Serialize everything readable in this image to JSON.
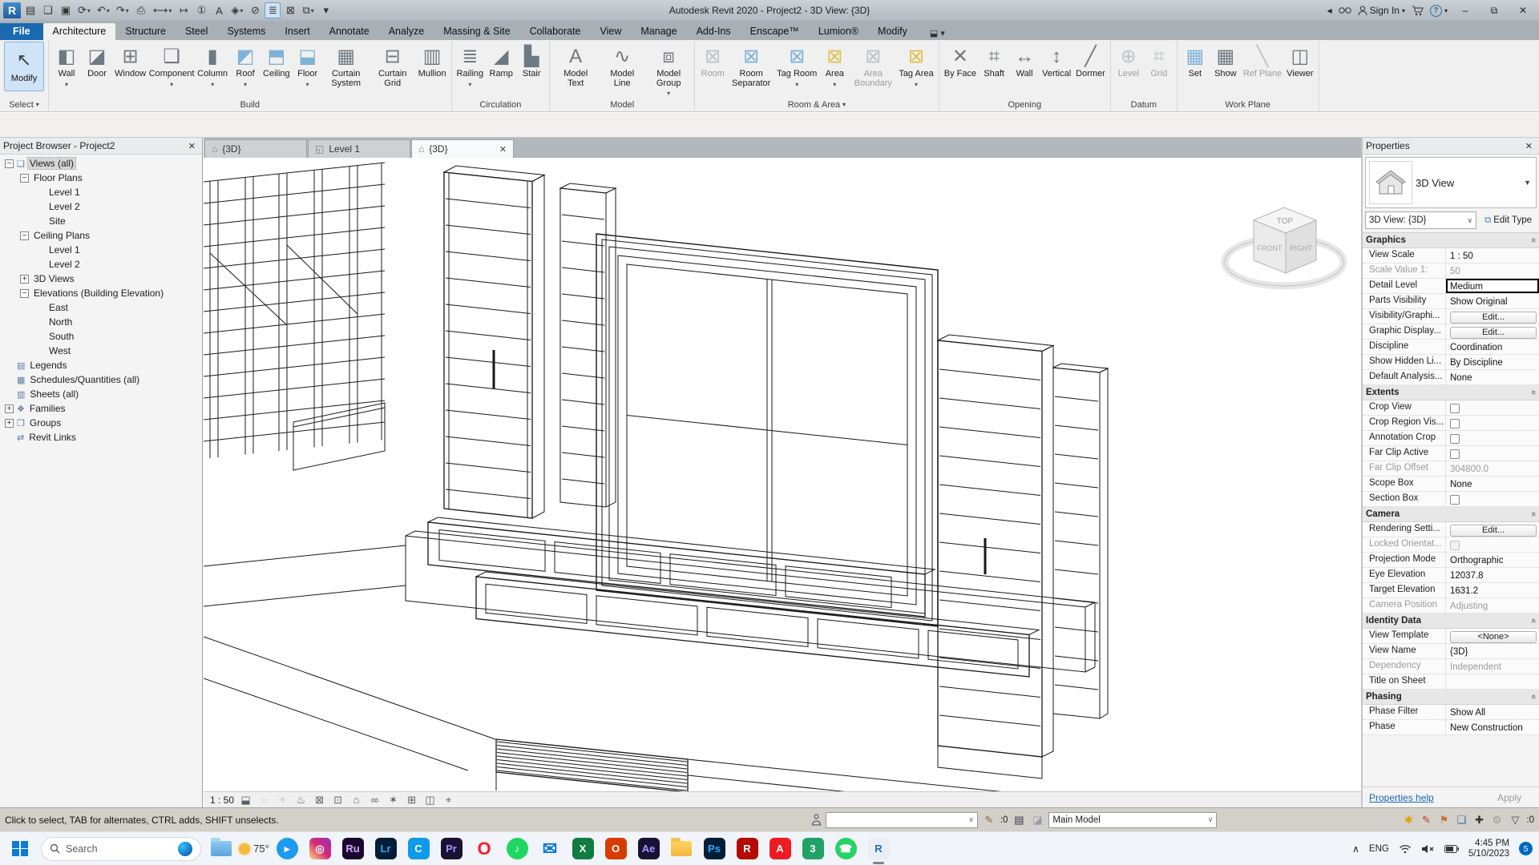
{
  "titlebar": {
    "title": "Autodesk Revit 2020 - Project2 - 3D View: {3D}",
    "sign_in": "Sign In",
    "qat": [
      {
        "name": "recent-documents",
        "glyph": "▤"
      },
      {
        "name": "open",
        "glyph": "❏"
      },
      {
        "name": "save",
        "glyph": "▣"
      },
      {
        "name": "sync",
        "glyph": "⟳",
        "arrow": true
      },
      {
        "name": "undo",
        "glyph": "↶",
        "arrow": true
      },
      {
        "name": "redo",
        "glyph": "↷",
        "arrow": true
      },
      {
        "name": "print",
        "glyph": "⎙"
      },
      {
        "name": "measure",
        "glyph": "⟷",
        "arrow": true
      },
      {
        "name": "aligned-dimension",
        "glyph": "↦"
      },
      {
        "name": "tag-by-category",
        "glyph": "①"
      },
      {
        "name": "text",
        "glyph": "A"
      },
      {
        "name": "default-3d-view",
        "glyph": "◈",
        "arrow": true
      },
      {
        "name": "section",
        "glyph": "⊘"
      },
      {
        "name": "thin-lines",
        "glyph": "≣",
        "active": true
      },
      {
        "name": "close-hidden-windows",
        "glyph": "⊠"
      },
      {
        "name": "switch-windows",
        "glyph": "⧉",
        "arrow": true
      },
      {
        "name": "customize-qat",
        "glyph": "▾"
      }
    ]
  },
  "ribbon": {
    "tabs": [
      "File",
      "Architecture",
      "Structure",
      "Steel",
      "Systems",
      "Insert",
      "Annotate",
      "Analyze",
      "Massing & Site",
      "Collaborate",
      "View",
      "Manage",
      "Add-Ins",
      "Enscape™",
      "Lumion®",
      "Modify"
    ],
    "active_tab": "Architecture",
    "modify_label": "Modify",
    "select_label": "Select",
    "panels": [
      {
        "label": "Build",
        "tools": [
          {
            "label": "Wall",
            "icon": "wall",
            "glyph": "◧",
            "arrow": true
          },
          {
            "label": "Door",
            "icon": "door",
            "glyph": "◪"
          },
          {
            "label": "Window",
            "icon": "window",
            "glyph": "⊞"
          },
          {
            "label": "Component",
            "icon": "component",
            "glyph": "❏",
            "arrow": true
          },
          {
            "label": "Column",
            "icon": "column",
            "glyph": "▮",
            "arrow": true
          },
          {
            "label": "Roof",
            "icon": "roof",
            "glyph": "◩",
            "arrow": true,
            "tint": "blue"
          },
          {
            "label": "Ceiling",
            "icon": "ceiling",
            "glyph": "⬒",
            "tint": "blue"
          },
          {
            "label": "Floor",
            "icon": "floor",
            "glyph": "⬓",
            "arrow": true,
            "tint": "blue"
          },
          {
            "label": "Curtain System",
            "icon": "curtain-system",
            "glyph": "▦"
          },
          {
            "label": "Curtain Grid",
            "icon": "curtain-grid",
            "glyph": "⊟"
          },
          {
            "label": "Mullion",
            "icon": "mullion",
            "glyph": "▥"
          }
        ]
      },
      {
        "label": "Circulation",
        "tools": [
          {
            "label": "Railing",
            "icon": "railing",
            "glyph": "≣",
            "arrow": true
          },
          {
            "label": "Ramp",
            "icon": "ramp",
            "glyph": "◢"
          },
          {
            "label": "Stair",
            "icon": "stair",
            "glyph": "▙"
          }
        ]
      },
      {
        "label": "Model",
        "tools": [
          {
            "label": "Model Text",
            "icon": "model-text",
            "glyph": "A"
          },
          {
            "label": "Model Line",
            "icon": "model-line",
            "glyph": "∿"
          },
          {
            "label": "Model Group",
            "icon": "model-group",
            "glyph": "⧈",
            "arrow": true
          }
        ]
      },
      {
        "label": "Room & Area",
        "arrow": true,
        "tools": [
          {
            "label": "Room",
            "icon": "room",
            "glyph": "⊠",
            "disabled": true
          },
          {
            "label": "Room Separator",
            "icon": "room-separator",
            "glyph": "⊠",
            "tint": "blue"
          },
          {
            "label": "Tag Room",
            "icon": "tag-room",
            "glyph": "⊠",
            "arrow": true,
            "tint": "blue"
          },
          {
            "label": "Area",
            "icon": "area",
            "glyph": "⊠",
            "arrow": true,
            "tint": "yellow"
          },
          {
            "label": "Area Boundary",
            "icon": "area-boundary",
            "glyph": "⊠",
            "disabled": true
          },
          {
            "label": "Tag Area",
            "icon": "tag-area",
            "glyph": "⊠",
            "arrow": true,
            "tint": "yellow"
          }
        ]
      },
      {
        "label": "Opening",
        "tools": [
          {
            "label": "By Face",
            "icon": "opening-by-face",
            "glyph": "✕"
          },
          {
            "label": "Shaft",
            "icon": "shaft-opening",
            "glyph": "⌗"
          },
          {
            "label": "Wall",
            "icon": "wall-opening",
            "glyph": "↔"
          },
          {
            "label": "Vertical",
            "icon": "vertical-opening",
            "glyph": "↕"
          },
          {
            "label": "Dormer",
            "icon": "dormer-opening",
            "glyph": "╱"
          }
        ]
      },
      {
        "label": "Datum",
        "tools": [
          {
            "label": "Level",
            "icon": "level",
            "glyph": "⊕",
            "disabled": true
          },
          {
            "label": "Grid",
            "icon": "grid",
            "glyph": "⌗",
            "disabled": true
          }
        ]
      },
      {
        "label": "Work Plane",
        "tools": [
          {
            "label": "Set",
            "icon": "workplane-set",
            "glyph": "▦",
            "tint": "blue"
          },
          {
            "label": "Show",
            "icon": "workplane-show",
            "glyph": "▦"
          },
          {
            "label": "Ref Plane",
            "icon": "ref-plane",
            "glyph": "╲",
            "disabled": true
          },
          {
            "label": "Viewer",
            "icon": "workplane-viewer",
            "glyph": "◫"
          }
        ]
      }
    ]
  },
  "browser": {
    "title": "Project Browser - Project2",
    "icon_glyphs": {
      "views": "❏",
      "legends": "▤",
      "schedules": "▦",
      "sheets": "▥",
      "families": "❖",
      "groups": "❒",
      "links": "⇄"
    },
    "items": [
      {
        "label": "Views (all)",
        "level": 0,
        "expand": "minus",
        "icon": "views",
        "selected": true
      },
      {
        "label": "Floor Plans",
        "level": 1,
        "expand": "minus"
      },
      {
        "label": "Level 1",
        "level": 2
      },
      {
        "label": "Level 2",
        "level": 2
      },
      {
        "label": "Site",
        "level": 2
      },
      {
        "label": "Ceiling Plans",
        "level": 1,
        "expand": "minus"
      },
      {
        "label": "Level 1",
        "level": 2
      },
      {
        "label": "Level 2",
        "level": 2
      },
      {
        "label": "3D Views",
        "level": 1,
        "expand": "plus"
      },
      {
        "label": "Elevations (Building Elevation)",
        "level": 1,
        "expand": "minus"
      },
      {
        "label": "East",
        "level": 2
      },
      {
        "label": "North",
        "level": 2
      },
      {
        "label": "South",
        "level": 2
      },
      {
        "label": "West",
        "level": 2
      },
      {
        "label": "Legends",
        "level": 0,
        "icon": "legends"
      },
      {
        "label": "Schedules/Quantities (all)",
        "level": 0,
        "icon": "schedules"
      },
      {
        "label": "Sheets (all)",
        "level": 0,
        "icon": "sheets"
      },
      {
        "label": "Families",
        "level": 0,
        "expand": "plus",
        "icon": "families"
      },
      {
        "label": "Groups",
        "level": 0,
        "expand": "plus",
        "icon": "groups"
      },
      {
        "label": "Revit Links",
        "level": 0,
        "icon": "links"
      }
    ]
  },
  "view_tabs": [
    {
      "label": "{3D}",
      "icon": "3d-view",
      "active": false
    },
    {
      "label": "Level 1",
      "icon": "plan-view",
      "active": false
    },
    {
      "label": "{3D}",
      "icon": "3d-view",
      "active": true,
      "close": true
    }
  ],
  "viewcube": {
    "top": "TOP",
    "front": "FRONT",
    "right": "RIGHT"
  },
  "viewbar": {
    "scale": "1 : 50",
    "icons": [
      {
        "name": "visual-style",
        "glyph": "⬓"
      },
      {
        "name": "sun-path",
        "glyph": "☼",
        "dim": true
      },
      {
        "name": "shadows",
        "glyph": "☀",
        "dim": true
      },
      {
        "name": "rendering-dialog",
        "glyph": "♨"
      },
      {
        "name": "crop-view",
        "glyph": "⊠"
      },
      {
        "name": "crop-region",
        "glyph": "⊡"
      },
      {
        "name": "lock-3d-view",
        "glyph": "⌂"
      },
      {
        "name": "temporary-hide-isolate",
        "glyph": "∞"
      },
      {
        "name": "reveal-hidden-elements",
        "glyph": "✶"
      },
      {
        "name": "temporary-view-properties",
        "glyph": "⊞"
      },
      {
        "name": "displacement-sets",
        "glyph": "◫"
      },
      {
        "name": "reveal-constraints",
        "glyph": "⌖"
      }
    ]
  },
  "statusbar": {
    "hint": "Click to select, TAB for alternates, CTRL adds, SHIFT unselects.",
    "requests": ":0",
    "workset_value": "",
    "design_option": "Main Model",
    "filter_count": ":0",
    "right_icons": [
      {
        "name": "select-links",
        "glyph": "✱",
        "color": "#d9a400"
      },
      {
        "name": "select-underlay",
        "glyph": "✎",
        "color": "#c23b22"
      },
      {
        "name": "select-pinned",
        "glyph": "⚑",
        "color": "#c87137"
      },
      {
        "name": "select-by-face",
        "glyph": "❏",
        "color": "#2a6fb0"
      },
      {
        "name": "drag-on-selection",
        "glyph": "✚",
        "color": "#333333"
      },
      {
        "name": "settings",
        "glyph": "⚙",
        "color": "#9a9a9a"
      }
    ]
  },
  "properties": {
    "header": "Properties",
    "type_label": "3D View",
    "instance_combo": "3D View: {3D}",
    "edit_type": "Edit Type",
    "help": "Properties help",
    "apply": "Apply",
    "sections": [
      {
        "title": "Graphics",
        "rows": [
          {
            "label": "View Scale",
            "value": "1 : 50",
            "kind": "text"
          },
          {
            "label": "Scale Value    1:",
            "value": "50",
            "kind": "disabled"
          },
          {
            "label": "Detail Level",
            "value": "Medium",
            "kind": "active"
          },
          {
            "label": "Parts Visibility",
            "value": "Show Original",
            "kind": "text"
          },
          {
            "label": "Visibility/Graphi...",
            "value": "Edit...",
            "kind": "button"
          },
          {
            "label": "Graphic Display...",
            "value": "Edit...",
            "kind": "button"
          },
          {
            "label": "Discipline",
            "value": "Coordination",
            "kind": "text"
          },
          {
            "label": "Show Hidden Li...",
            "value": "By Discipline",
            "kind": "text"
          },
          {
            "label": "Default Analysis...",
            "value": "None",
            "kind": "text"
          }
        ]
      },
      {
        "title": "Extents",
        "rows": [
          {
            "label": "Crop View",
            "value": "",
            "kind": "checkbox"
          },
          {
            "label": "Crop Region Vis...",
            "value": "",
            "kind": "checkbox"
          },
          {
            "label": "Annotation Crop",
            "value": "",
            "kind": "checkbox"
          },
          {
            "label": "Far Clip Active",
            "value": "",
            "kind": "checkbox"
          },
          {
            "label": "Far Clip Offset",
            "value": "304800.0",
            "kind": "disabled"
          },
          {
            "label": "Scope Box",
            "value": "None",
            "kind": "text"
          },
          {
            "label": "Section Box",
            "value": "",
            "kind": "checkbox"
          }
        ]
      },
      {
        "title": "Camera",
        "rows": [
          {
            "label": "Rendering Setti...",
            "value": "Edit...",
            "kind": "button"
          },
          {
            "label": "Locked Orientat...",
            "value": "",
            "kind": "checkbox-disabled"
          },
          {
            "label": "Projection Mode",
            "value": "Orthographic",
            "kind": "text"
          },
          {
            "label": "Eye Elevation",
            "value": "12037.8",
            "kind": "text"
          },
          {
            "label": "Target Elevation",
            "value": "1631.2",
            "kind": "text"
          },
          {
            "label": "Camera Position",
            "value": "Adjusting",
            "kind": "disabled"
          }
        ]
      },
      {
        "title": "Identity Data",
        "rows": [
          {
            "label": "View Template",
            "value": "<None>",
            "kind": "button"
          },
          {
            "label": "View Name",
            "value": "{3D}",
            "kind": "text"
          },
          {
            "label": "Dependency",
            "value": "Independent",
            "kind": "disabled"
          },
          {
            "label": "Title on Sheet",
            "value": "",
            "kind": "text"
          }
        ]
      },
      {
        "title": "Phasing",
        "rows": [
          {
            "label": "Phase Filter",
            "value": "Show All",
            "kind": "text"
          },
          {
            "label": "Phase",
            "value": "New Construction",
            "kind": "text"
          }
        ]
      }
    ]
  },
  "taskbar": {
    "search": "Search",
    "weather": "75°",
    "apps": [
      {
        "name": "file-explorer",
        "kind": "folder",
        "style": "blue"
      },
      {
        "name": "weather",
        "kind": "weather"
      },
      {
        "name": "video-app",
        "kind": "tile",
        "shape": "circle",
        "bg": "#1d9bf0",
        "glyph": "▸"
      },
      {
        "name": "instagram",
        "kind": "tile",
        "bg": "linear-gradient(45deg,#feda75,#d62976,#962fbf)",
        "glyph": "◎"
      },
      {
        "name": "premiere-rush",
        "kind": "tile",
        "bg": "#19082d",
        "fg": "#d6a1ff",
        "glyph": "Ru"
      },
      {
        "name": "lightroom",
        "kind": "tile",
        "bg": "#001e36",
        "fg": "#31a8ff",
        "glyph": "Lr"
      },
      {
        "name": "code",
        "kind": "tile",
        "bg": "#0e9be8",
        "glyph": "C"
      },
      {
        "name": "premiere",
        "kind": "tile",
        "bg": "#1a1034",
        "fg": "#9999ff",
        "glyph": "Pr"
      },
      {
        "name": "opera",
        "kind": "glyph",
        "fg": "#ff1b2d",
        "glyph": "O"
      },
      {
        "name": "spotify",
        "kind": "tile",
        "shape": "circle",
        "bg": "#1ed760",
        "glyph": "♪"
      },
      {
        "name": "mail",
        "kind": "glyph",
        "fg": "#0b78d1",
        "glyph": "✉"
      },
      {
        "name": "excel",
        "kind": "tile",
        "bg": "#107c41",
        "glyph": "X"
      },
      {
        "name": "office",
        "kind": "tile",
        "bg": "#d83b01",
        "glyph": "O"
      },
      {
        "name": "after-effects",
        "kind": "tile",
        "bg": "#1a1034",
        "fg": "#9999ff",
        "glyph": "Ae"
      },
      {
        "name": "folder",
        "kind": "folder",
        "style": "yellow"
      },
      {
        "name": "photoshop",
        "kind": "tile",
        "bg": "#001e36",
        "fg": "#31a8ff",
        "glyph": "Ps"
      },
      {
        "name": "reader",
        "kind": "tile",
        "bg": "#b30b00",
        "glyph": "R"
      },
      {
        "name": "red-a-app",
        "kind": "tile",
        "bg": "#ed1c24",
        "glyph": "A"
      },
      {
        "name": "green-3-app",
        "kind": "tile",
        "bg": "#21a366",
        "glyph": "3"
      },
      {
        "name": "whatsapp",
        "kind": "tile",
        "shape": "circle",
        "bg": "#25d366",
        "glyph": "☎"
      },
      {
        "name": "revit-taskbar",
        "kind": "tile",
        "bg": "#e9eef5",
        "fg": "#1f6fb5",
        "glyph": "R",
        "running": true
      }
    ],
    "tray": {
      "lang": "ENG",
      "time": "4:45 PM",
      "date": "5/10/2023",
      "badge": "5"
    }
  }
}
